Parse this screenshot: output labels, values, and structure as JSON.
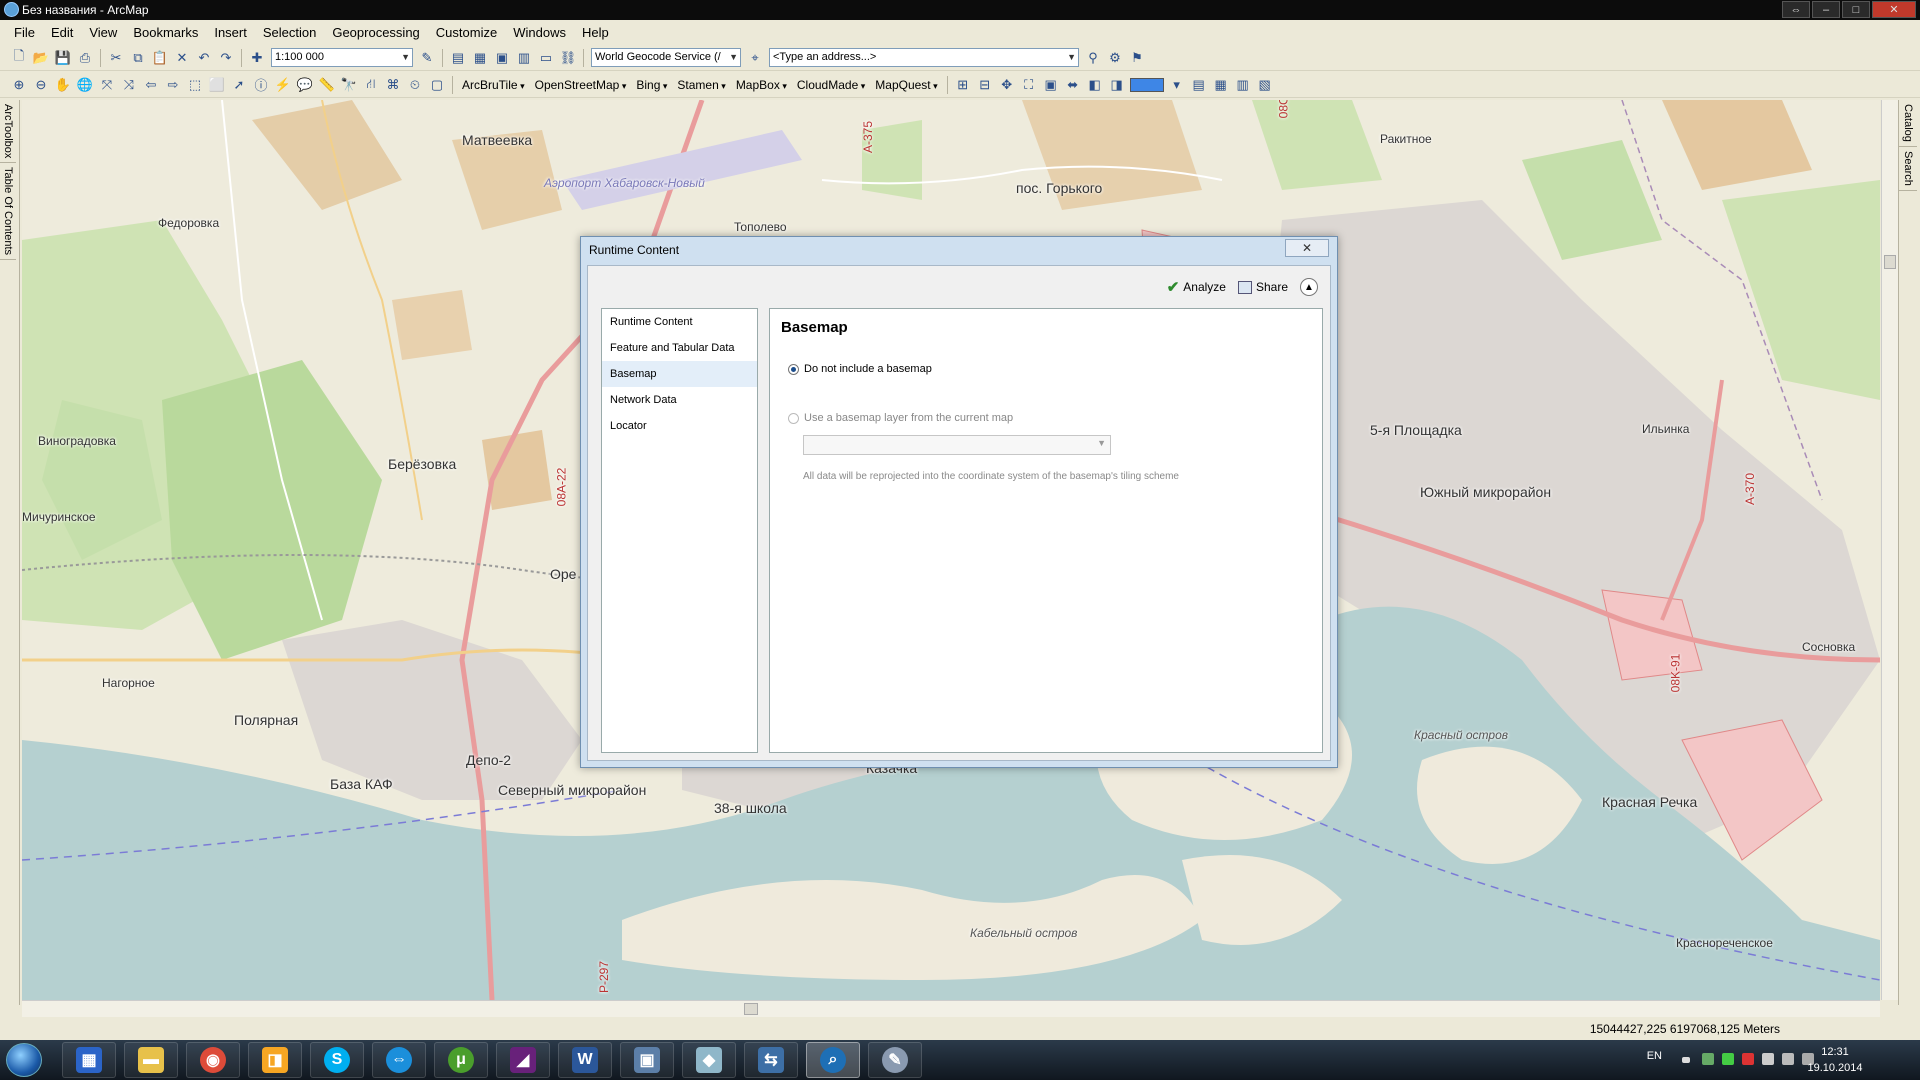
{
  "window": {
    "title": "Без названия - ArcMap"
  },
  "menu": [
    "File",
    "Edit",
    "View",
    "Bookmarks",
    "Insert",
    "Selection",
    "Geoprocessing",
    "Customize",
    "Windows",
    "Help"
  ],
  "toolbar": {
    "scale": "1:100 000",
    "geocode_service": "World Geocode Service (/",
    "address_placeholder": "<Type an address...>",
    "basemap_menus": [
      "ArcBruTile",
      "OpenStreetMap",
      "Bing",
      "Stamen",
      "MapBox",
      "CloudMade",
      "MapQuest"
    ]
  },
  "docks": {
    "left": [
      "ArcToolbox",
      "Table Of Contents"
    ],
    "right": [
      "Catalog",
      "Search"
    ]
  },
  "map": {
    "places": [
      {
        "name": "Матвеевка"
      },
      {
        "name": "Аэропорт Хабаровск-Новый"
      },
      {
        "name": "пос. Горького"
      },
      {
        "name": "Федоровка"
      },
      {
        "name": "Тополево"
      },
      {
        "name": "Ракитное"
      },
      {
        "name": "Виноградовка"
      },
      {
        "name": "Берёзовка"
      },
      {
        "name": "Мичуринское"
      },
      {
        "name": "Оре"
      },
      {
        "name": "5-я Площадка"
      },
      {
        "name": "Ильинка"
      },
      {
        "name": "Южный микрорайон"
      },
      {
        "name": "Нагорное"
      },
      {
        "name": "Полярная"
      },
      {
        "name": "База КАФ"
      },
      {
        "name": "Депо-2"
      },
      {
        "name": "Северный микрорайон"
      },
      {
        "name": "38-я школа"
      },
      {
        "name": "Казачка"
      },
      {
        "name": "Сосновка"
      },
      {
        "name": "Красный остров"
      },
      {
        "name": "Красная Речка"
      },
      {
        "name": "Кабельный остров"
      },
      {
        "name": "Краснореченское"
      }
    ],
    "road_labels": [
      "A-375",
      "08A-22",
      "08K-91",
      "A-370",
      "08O",
      "P-297"
    ]
  },
  "status": {
    "coordinates": "15044427,225  6197068,125 Meters"
  },
  "dialog": {
    "title": "Runtime Content",
    "close_label": "✕",
    "actions": {
      "analyze": "Analyze",
      "share": "Share"
    },
    "nav": [
      "Runtime Content",
      "Feature and Tabular Data",
      "Basemap",
      "Network Data",
      "Locator"
    ],
    "selected_nav": "Basemap",
    "panel": {
      "heading": "Basemap",
      "option_none": "Do not include a basemap",
      "option_layer": "Use a basemap layer from the current map",
      "note": "All data will be reprojected into the coordinate system of the basemap's tiling scheme"
    }
  },
  "taskbar": {
    "lang": "EN",
    "time": "12:31",
    "date": "19.10.2014"
  }
}
